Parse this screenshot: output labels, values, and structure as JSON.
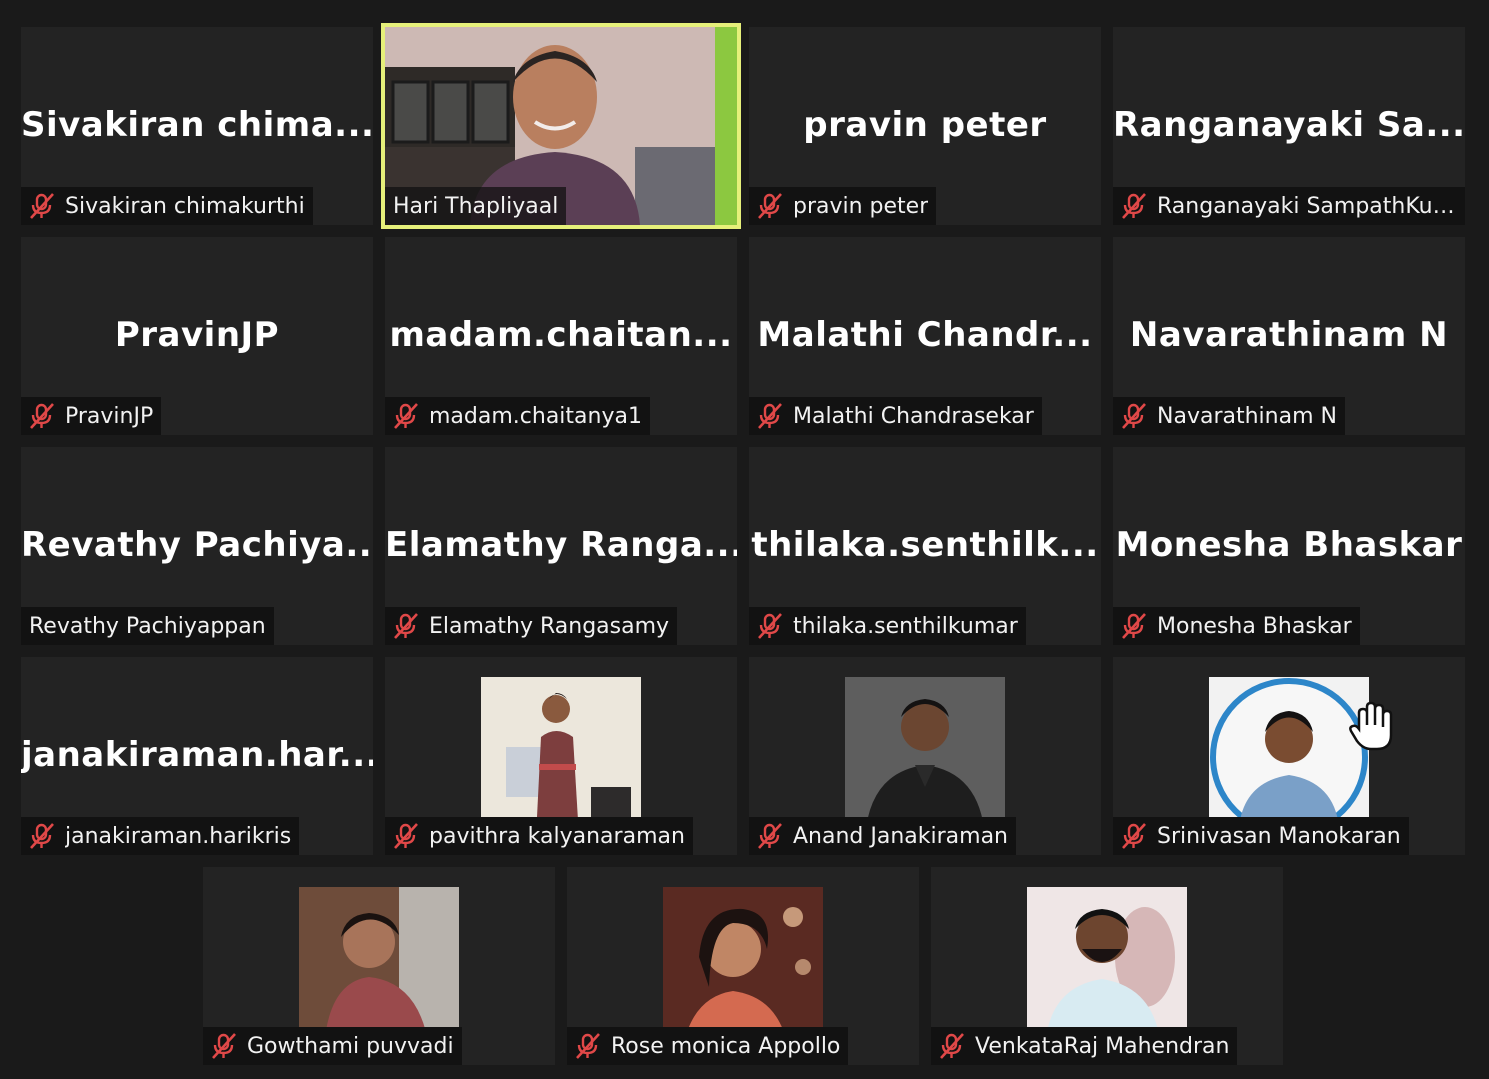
{
  "participants": [
    {
      "tile_name": "Sivakiran  chima...",
      "label": "Sivakiran chimakurthi",
      "muted": true
    },
    {
      "tile_name": "",
      "label": "Hari Thapliyaal",
      "muted": false,
      "video": true,
      "active_speaker": true
    },
    {
      "tile_name": "pravin peter",
      "label": "pravin peter",
      "muted": true
    },
    {
      "tile_name": "Ranganayaki  Sa...",
      "label": "Ranganayaki SampathKum...",
      "muted": true
    },
    {
      "tile_name": "PravinJP",
      "label": "PravinJP",
      "muted": true
    },
    {
      "tile_name": "madam.chaitan...",
      "label": "madam.chaitanya1",
      "muted": true
    },
    {
      "tile_name": "Malathi  Chandr...",
      "label": "Malathi Chandrasekar",
      "muted": true
    },
    {
      "tile_name": "Navarathinam N",
      "label": "Navarathinam N",
      "muted": true
    },
    {
      "tile_name": "Revathy  Pachiya...",
      "label": "Revathy Pachiyappan",
      "muted": false
    },
    {
      "tile_name": "Elamathy  Ranga...",
      "label": "Elamathy Rangasamy",
      "muted": true
    },
    {
      "tile_name": "thilaka.senthilk...",
      "label": "thilaka.senthilkumar",
      "muted": true
    },
    {
      "tile_name": "Monesha Bhaskar",
      "label": "Monesha Bhaskar",
      "muted": true
    },
    {
      "tile_name": "janakiraman.har...",
      "label": "janakiraman.harikris",
      "muted": true
    },
    {
      "tile_name": "",
      "label": "pavithra kalyanaraman",
      "muted": true,
      "profile_photo": true
    },
    {
      "tile_name": "",
      "label": "Anand Janakiraman",
      "muted": true,
      "profile_photo": true
    },
    {
      "tile_name": "",
      "label": "Srinivasan Manokaran",
      "muted": true,
      "profile_photo": true,
      "hand_raised": true
    },
    {
      "tile_name": "",
      "label": "Gowthami puvvadi",
      "muted": true,
      "profile_photo": true
    },
    {
      "tile_name": "",
      "label": "Rose monica Appollo",
      "muted": true,
      "profile_photo": true
    },
    {
      "tile_name": "",
      "label": "VenkataRaj Mahendran",
      "muted": true,
      "profile_photo": true
    }
  ],
  "colors": {
    "background": "#1a1a1a",
    "tile": "#232323",
    "active_speaker_border": "#e6f07a",
    "muted_icon": "#e04848"
  },
  "icons": {
    "muted": "mic-muted-icon",
    "hand": "raised-hand-icon"
  }
}
